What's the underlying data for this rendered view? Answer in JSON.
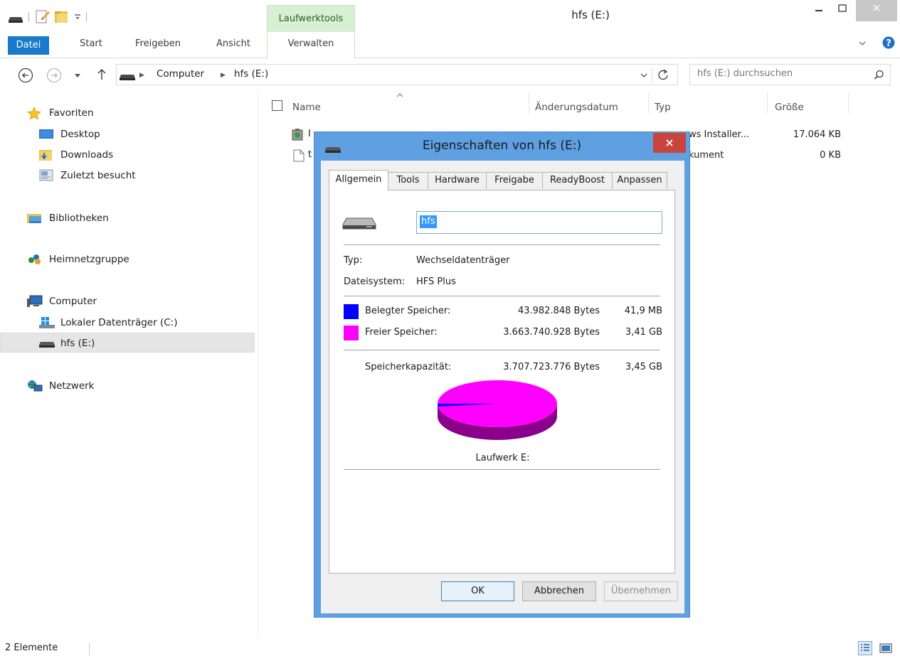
{
  "window": {
    "title": "hfs (E:)",
    "context_group": "Laufwerktools"
  },
  "ribbon": {
    "tabs": [
      "Datei",
      "Start",
      "Freigeben",
      "Ansicht",
      "Verwalten"
    ]
  },
  "address": {
    "crumbs": [
      "Computer",
      "hfs (E:)"
    ],
    "search_placeholder": "hfs (E:) durchsuchen"
  },
  "nav": {
    "favorites": "Favoriten",
    "desktop": "Desktop",
    "downloads": "Downloads",
    "recent": "Zuletzt besucht",
    "libraries": "Bibliotheken",
    "homegroup": "Heimnetzgruppe",
    "computer": "Computer",
    "drive_c": "Lokaler Datenträger (C:)",
    "drive_e": "hfs (E:)",
    "network": "Netzwerk"
  },
  "filelist": {
    "columns": [
      "Name",
      "Änderungsdatum",
      "Typ",
      "Größe"
    ],
    "rows": [
      {
        "name": "I",
        "type": "ws Installer...",
        "size": "17.064 KB"
      },
      {
        "name": "t",
        "type": "kument",
        "size": "0 KB"
      }
    ]
  },
  "status": {
    "count": "2 Elemente"
  },
  "dialog": {
    "title": "Eigenschaften von hfs (E:)",
    "tabs": [
      "Allgemein",
      "Tools",
      "Hardware",
      "Freigabe",
      "ReadyBoost",
      "Anpassen"
    ],
    "name_value": "hfs",
    "type_label": "Typ:",
    "type_value": "Wechseldatenträger",
    "fs_label": "Dateisystem:",
    "fs_value": "HFS Plus",
    "used_label": "Belegter Speicher:",
    "used_bytes": "43.982.848 Bytes",
    "used_size": "41,9 MB",
    "free_label": "Freier Speicher:",
    "free_bytes": "3.663.740.928 Bytes",
    "free_size": "3,41 GB",
    "capacity_label": "Speicherkapazität:",
    "capacity_bytes": "3.707.723.776 Bytes",
    "capacity_size": "3,45 GB",
    "drive_label": "Laufwerk E:",
    "used_fraction": 0.0119,
    "colors": {
      "used": "#0000ff",
      "free": "#ff00ff",
      "free_side": "#8b008b"
    },
    "buttons": {
      "ok": "OK",
      "cancel": "Abbrechen",
      "apply": "Übernehmen"
    }
  }
}
